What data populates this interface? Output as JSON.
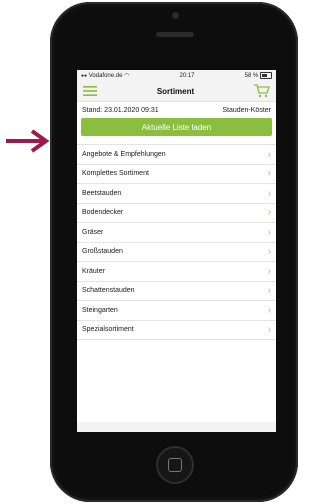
{
  "status_bar": {
    "carrier": "Vodafone.de",
    "time": "20:17",
    "battery": "58 %"
  },
  "nav": {
    "title": "Sortiment"
  },
  "info": {
    "stand": "Stand: 23.01.2020 09:31",
    "company": "Stauden-Köster"
  },
  "load_button": {
    "label": "Aktuelle Liste laden"
  },
  "list": {
    "items": [
      {
        "label": "Angebote & Empfehlungen"
      },
      {
        "label": "Komplettes Sortiment"
      },
      {
        "label": "Beetstauden"
      },
      {
        "label": "Bodendecker"
      },
      {
        "label": "Gräser"
      },
      {
        "label": "Großstauden"
      },
      {
        "label": "Kräuter"
      },
      {
        "label": "Schattenstauden"
      },
      {
        "label": "Steingarten"
      },
      {
        "label": "Spezialsortiment"
      }
    ]
  },
  "colors": {
    "accent": "#8bbd3e",
    "annotation_arrow": "#9b1b4a"
  },
  "icons": [
    "arrow-right-icon",
    "hamburger-menu-icon",
    "cart-icon",
    "wifi-icon",
    "battery-icon",
    "chevron-right-icon"
  ]
}
